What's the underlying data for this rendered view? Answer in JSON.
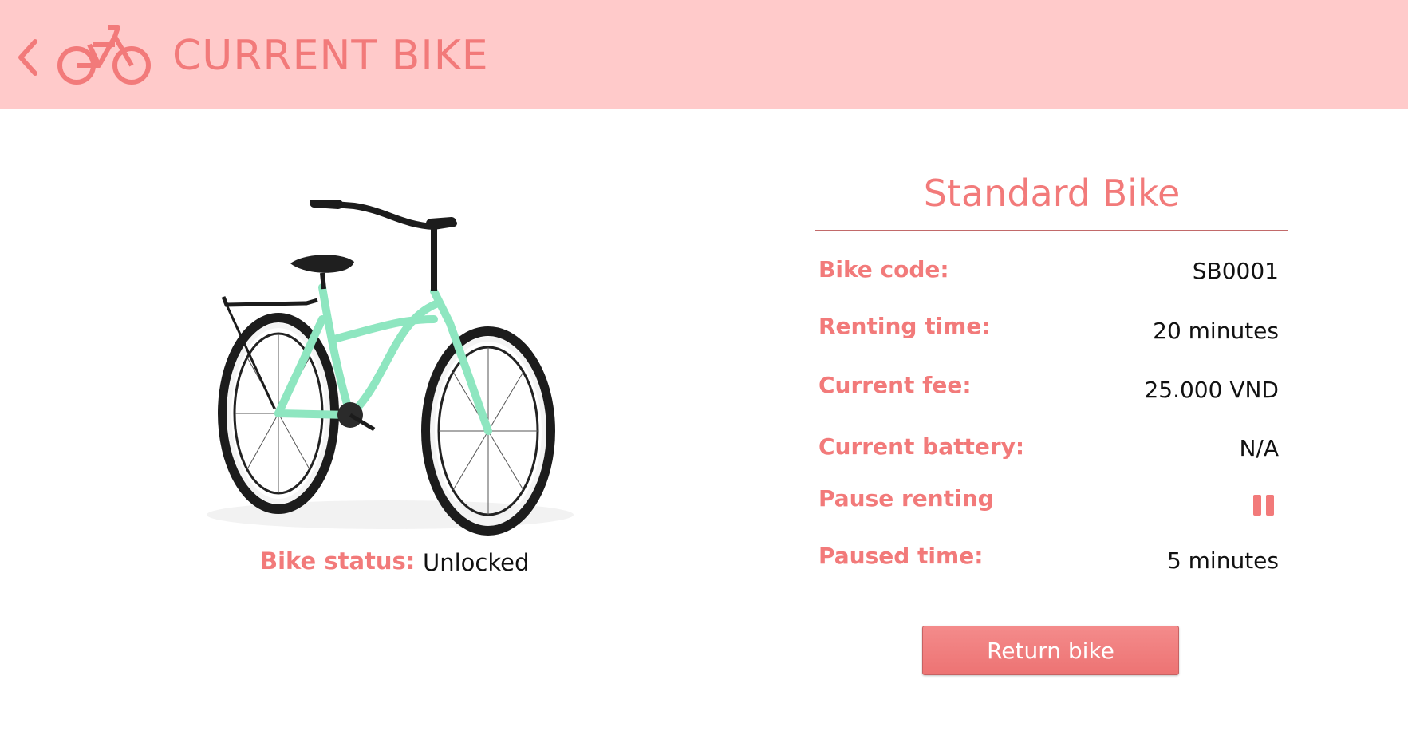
{
  "header": {
    "title": "CURRENT BIKE",
    "back_icon": "chevron-left-icon",
    "bike_icon": "bicycle-icon"
  },
  "bike": {
    "image": "bicycle-photo",
    "status_label": "Bike status:",
    "status_value": "Unlocked"
  },
  "details": {
    "title": "Standard Bike",
    "rows": [
      {
        "label": "Bike code:",
        "value": "SB0001"
      },
      {
        "label": "Renting time:",
        "value": "20 minutes"
      },
      {
        "label": "Current fee:",
        "value": "25.000 VND"
      },
      {
        "label": "Current battery:",
        "value": "N/A"
      },
      {
        "label": "Pause renting",
        "icon": "pause-icon"
      },
      {
        "label": "Paused time:",
        "value": "5 minutes"
      }
    ]
  },
  "actions": {
    "return_label": "Return bike"
  },
  "colors": {
    "header_bg": "#ffcaca",
    "accent": "#f27a7a",
    "divider": "#c26a6a",
    "button": "#ef7b7b"
  }
}
